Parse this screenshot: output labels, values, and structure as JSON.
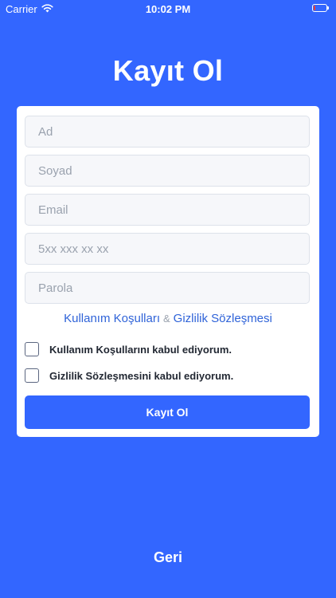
{
  "status_bar": {
    "carrier": "Carrier",
    "time": "10:02 PM",
    "battery_level_percent": 15,
    "battery_color": "#ff3b30"
  },
  "title": "Kayıt Ol",
  "form": {
    "fields": [
      {
        "name": "first-name",
        "placeholder": "Ad",
        "value": ""
      },
      {
        "name": "last-name",
        "placeholder": "Soyad",
        "value": ""
      },
      {
        "name": "email",
        "placeholder": "Email",
        "value": ""
      },
      {
        "name": "phone",
        "placeholder": "5xx xxx xx xx",
        "value": ""
      },
      {
        "name": "password",
        "placeholder": "Parola",
        "value": ""
      }
    ],
    "links": {
      "terms": "Kullanım Koşulları",
      "separator": "&",
      "privacy": "Gizlilik Sözleşmesi"
    },
    "checkboxes": [
      {
        "label": "Kullanım Koşullarını kabul ediyorum.",
        "checked": false
      },
      {
        "label": "Gizlilik Sözleşmesini kabul ediyorum.",
        "checked": false
      }
    ],
    "submit_label": "Kayıt Ol"
  },
  "back_label": "Geri",
  "colors": {
    "background": "#3366ff",
    "link": "#2f63d8",
    "field_background": "#f6f7fa"
  },
  "icons": {
    "wifi": "wifi-icon",
    "battery": "battery-icon"
  }
}
